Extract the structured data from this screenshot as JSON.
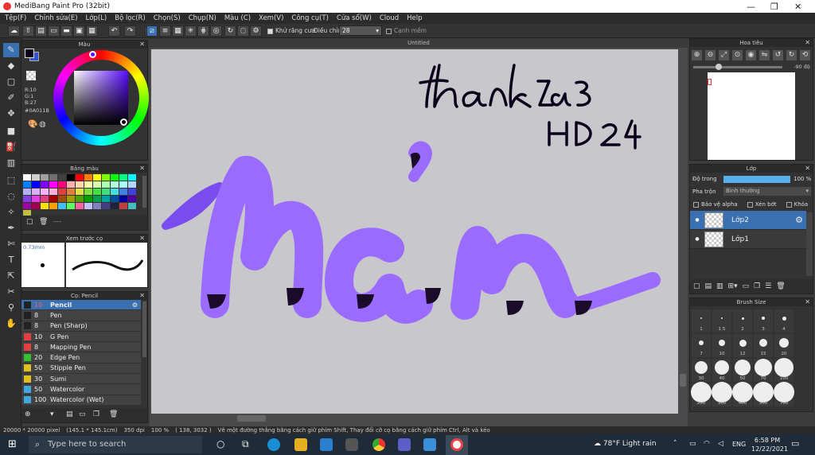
{
  "window": {
    "title": "MediBang Paint Pro (32bit)"
  },
  "menu": [
    "Tệp(F)",
    "Chỉnh sửa(E)",
    "Lớp(L)",
    "Bộ lọc(R)",
    "Chọn(S)",
    "Chụp(N)",
    "Màu (C)",
    "Xem(V)",
    "Công cụ(T)",
    "Cửa sổ(W)",
    "Cloud",
    "Help"
  ],
  "toolbar": {
    "antialias_label": "Khử răng cưa",
    "adjust_label": "Điều chỉnh",
    "adjust_value": "28",
    "smooth_label": "Cạnh mềm"
  },
  "color_panel": {
    "title": "Màu",
    "r": "R:10",
    "g": "G:1",
    "b": "B:27",
    "hex": "#0A011B",
    "fg": "#0a011b",
    "bg": "#3355cc"
  },
  "swatch_panel": {
    "title": "Bảng màu",
    "label": "----",
    "colors": [
      "#ffffff",
      "#d0d0d0",
      "#a0a0a0",
      "#707070",
      "#404040",
      "#000000",
      "#ff0000",
      "#ff8000",
      "#ffff00",
      "#80ff00",
      "#00ff00",
      "#00ff80",
      "#00ffff",
      "#0080ff",
      "#0000ff",
      "#8000ff",
      "#ff00ff",
      "#ff0080",
      "#ffb0b0",
      "#ffd8b0",
      "#ffffb0",
      "#d8ffb0",
      "#b0ffb0",
      "#b0ffd8",
      "#b0ffff",
      "#b0d8ff",
      "#b0b0ff",
      "#d8b0ff",
      "#ffb0ff",
      "#ffb0d8",
      "#e04040",
      "#e08040",
      "#e0e040",
      "#80e040",
      "#40e040",
      "#40e080",
      "#40e0e0",
      "#4080e0",
      "#4040e0",
      "#8040e0",
      "#e040e0",
      "#e04080",
      "#a00000",
      "#a05000",
      "#a0a000",
      "#50a000",
      "#00a000",
      "#00a050",
      "#00a0a0",
      "#0050a0",
      "#0000a0",
      "#5000a0",
      "#a000a0",
      "#a00050",
      "#ffe000",
      "#ffa000",
      "#40c0ff",
      "#60ff60",
      "#ff60a0",
      "#c0c0ff",
      "#8080c0",
      "#404080",
      "#202040",
      "#c04040",
      "#40c0c0",
      "#c0c040"
    ]
  },
  "preview_panel": {
    "title": "Xem trước cọ",
    "size": "0.73mm"
  },
  "brush_panel": {
    "title": "Cọ: Pencil",
    "brushes": [
      {
        "size": "10",
        "name": "Pencil",
        "color": "#222222"
      },
      {
        "size": "8",
        "name": "Pen",
        "color": "#222222"
      },
      {
        "size": "8",
        "name": "Pen (Sharp)",
        "color": "#222222"
      },
      {
        "size": "10",
        "name": "G Pen",
        "color": "#e04040"
      },
      {
        "size": "8",
        "name": "Mapping Pen",
        "color": "#e04040"
      },
      {
        "size": "20",
        "name": "Edge Pen",
        "color": "#30c030"
      },
      {
        "size": "50",
        "name": "Stipple Pen",
        "color": "#e0c020"
      },
      {
        "size": "30",
        "name": "Sumi",
        "color": "#e0c020"
      },
      {
        "size": "50",
        "name": "Watercolor",
        "color": "#40a8e0"
      },
      {
        "size": "100",
        "name": "Watercolor (Wet)",
        "color": "#40a8e0"
      }
    ]
  },
  "canvas": {
    "title": "Untitled"
  },
  "navigator_panel": {
    "title": "Hoa tiêu",
    "angle": "-90 độ"
  },
  "layer_panel": {
    "title": "Lớp",
    "opacity_label": "Độ trong",
    "opacity_value": "100 %",
    "opacity_fraction": 1.0,
    "blend_label": "Pha trộn",
    "blend_value": "Bình thường",
    "protect_alpha": "Bảo vệ alpha",
    "clip": "Xén bớt",
    "lock": "Khóa",
    "layers": [
      {
        "name": "Lớp2",
        "selected": true
      },
      {
        "name": "Lớp1",
        "selected": false
      }
    ]
  },
  "brushsize_panel": {
    "title": "Brush Size",
    "sizes": [
      "1",
      "1.5",
      "2",
      "3",
      "4",
      "7",
      "10",
      "12",
      "15",
      "20",
      "30",
      "40",
      "50",
      "70",
      "100",
      "200",
      "300",
      "400",
      "500",
      "700"
    ]
  },
  "status": {
    "dimensions": "20000 * 20000 pixel",
    "physical": "(145.1 * 145.1cm)",
    "dpi": "350 dpi",
    "zoom": "100 %",
    "coords": "( 138, 3032 )",
    "hint": "Vẽ một đường thẳng bằng cách giữ phím Shift, Thay đổi cỡ cọ bằng cách giữ phím Ctrl, Alt và kéo"
  },
  "taskbar": {
    "search_placeholder": "Type here to search",
    "weather": "78°F  Light rain",
    "lang": "ENG",
    "time": "6:58 PM",
    "date": "12/22/2021"
  }
}
